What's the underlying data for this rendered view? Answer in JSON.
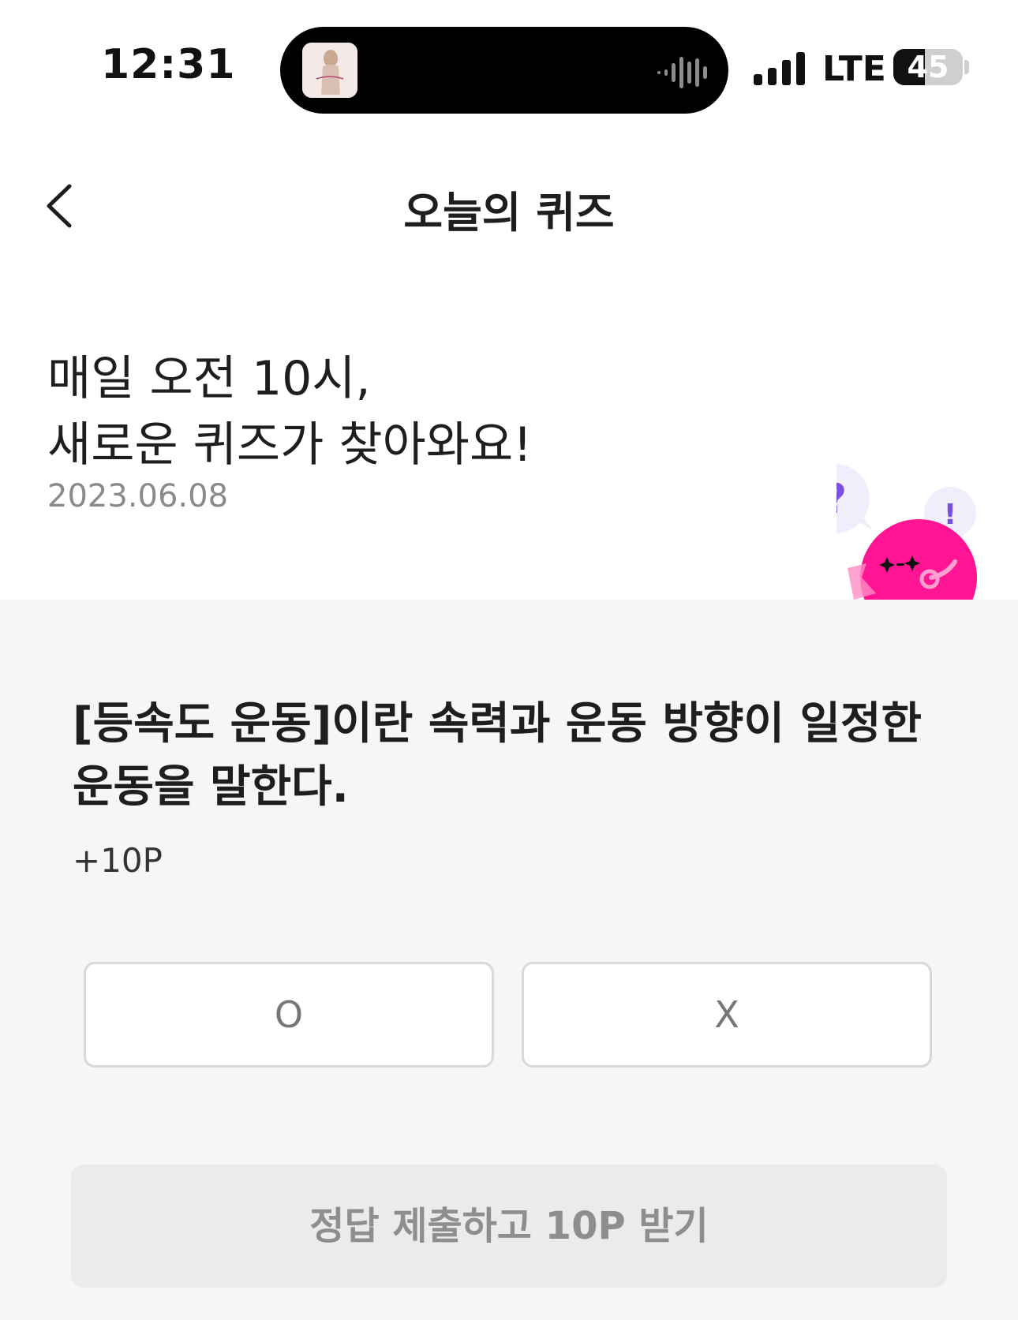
{
  "status_bar": {
    "time": "12:31",
    "network": "LTE",
    "battery": "45",
    "battery_level_percent": 45
  },
  "nav": {
    "title": "오늘의 퀴즈",
    "back_icon": "chevron-left-icon"
  },
  "header": {
    "line1": "매일 오전 10시,",
    "line2": "새로운 퀴즈가 찾아와요!",
    "date": "2023.06.08"
  },
  "mascot": {
    "bubble_question": "?",
    "bubble_exclaim": "!"
  },
  "quiz": {
    "question": "[등속도 운동]이란 속력과 운동 방향이 일정한 운동을 말한다.",
    "points": "+10P",
    "option_o": "O",
    "option_x": "X",
    "submit_label": "정답 제출하고 10P 받기"
  },
  "colors": {
    "accent_pink": "#ff1493",
    "bubble_purple": "#7b4fe0",
    "section_bg": "#f6f6f6"
  }
}
